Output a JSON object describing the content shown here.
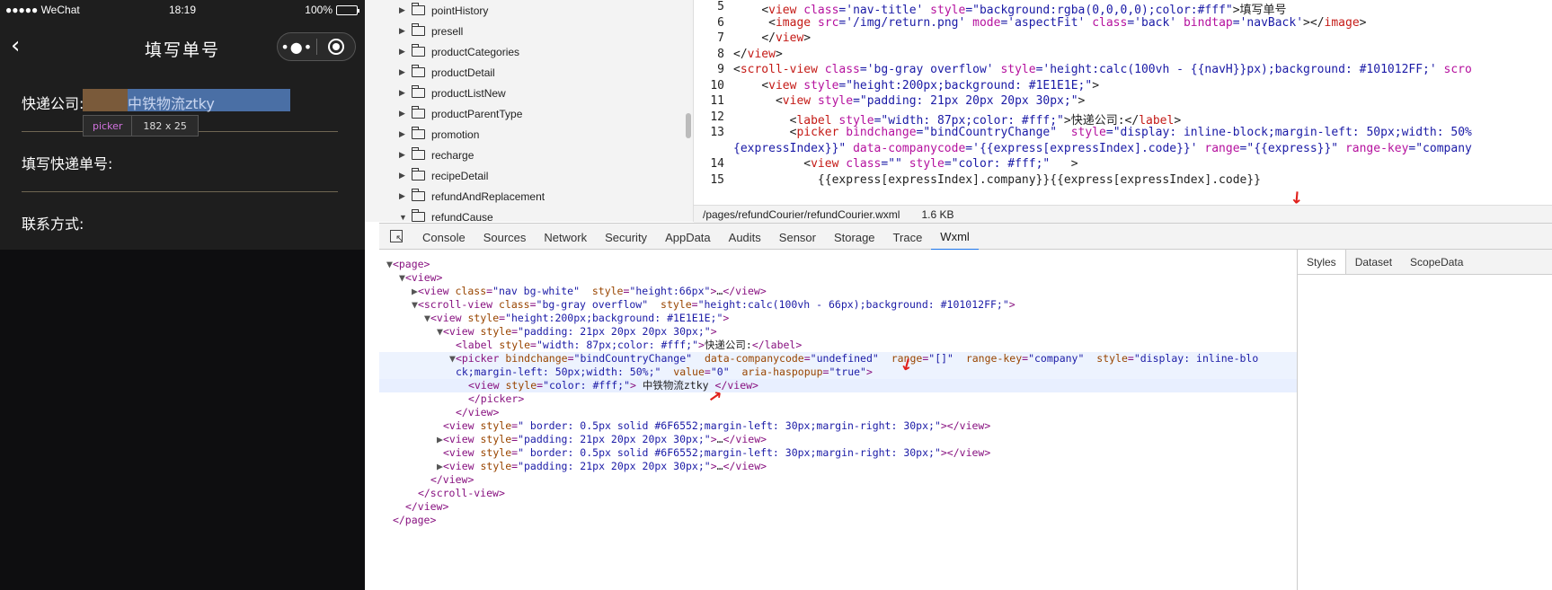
{
  "phone": {
    "carrier": "●●●●● WeChat",
    "time": "18:19",
    "battery": "100%",
    "battery_level": 1.0,
    "nav_title": "填写单号",
    "back_glyph": "‹",
    "more_glyph": "•●•",
    "form": {
      "company_label": "快递公司:",
      "company_value": "中铁物流ztky",
      "tracking_label": "填写快递单号:",
      "contact_label": "联系方式:"
    },
    "tooltip": {
      "tag": "picker",
      "size": "182 x 25"
    }
  },
  "filetree": {
    "items": [
      {
        "name": "pointHistory",
        "expanded": false
      },
      {
        "name": "presell",
        "expanded": false
      },
      {
        "name": "productCategories",
        "expanded": false
      },
      {
        "name": "productDetail",
        "expanded": false
      },
      {
        "name": "productListNew",
        "expanded": false
      },
      {
        "name": "productParentType",
        "expanded": false
      },
      {
        "name": "promotion",
        "expanded": false
      },
      {
        "name": "recharge",
        "expanded": false
      },
      {
        "name": "recipeDetail",
        "expanded": false
      },
      {
        "name": "refundAndReplacement",
        "expanded": false
      },
      {
        "name": "refundCause",
        "expanded": true
      }
    ]
  },
  "editor": {
    "lines": [
      {
        "n": "5",
        "indent": "    ",
        "html": "<span class='t'>&lt;</span><span class='r'>view</span> <span class='a'>class</span>=<span class='s'>'nav-title'</span> <span class='a'>style</span>=<span class='s'>\"background:rgba(0,0,0,0);color:#fff\"</span><span class='t'>&gt;填写单号</span>"
      },
      {
        "n": "6",
        "indent": "     ",
        "html": "<span class='t'>&lt;</span><span class='r'>image</span> <span class='a'>src</span>=<span class='s'>'/img/return.png'</span> <span class='a'>mode</span>=<span class='s'>'aspectFit'</span> <span class='a'>class</span>=<span class='s'>'back'</span> <span class='a'>bindtap</span>=<span class='s'>'navBack'</span><span class='t'>&gt;&lt;/</span><span class='r'>image</span><span class='t'>&gt;</span>"
      },
      {
        "n": "7",
        "indent": "    ",
        "html": "<span class='t'>&lt;/</span><span class='r'>view</span><span class='t'>&gt;</span>"
      },
      {
        "n": "8",
        "indent": "",
        "html": "<span class='t'>&lt;/</span><span class='r'>view</span><span class='t'>&gt;</span>"
      },
      {
        "n": "9",
        "indent": "",
        "html": "<span class='t'>&lt;</span><span class='r'>scroll-view</span> <span class='a'>class</span>=<span class='s'>'bg-gray overflow'</span> <span class='a'>style</span>=<span class='s'>'height:calc(100vh - {{navH}}px);background: #101012FF;'</span> <span class='a'>scro</span>"
      },
      {
        "n": "10",
        "indent": "    ",
        "html": "<span class='t'>&lt;</span><span class='r'>view</span> <span class='a'>style</span>=<span class='s'>\"height:200px;background: #1E1E1E;\"</span><span class='t'>&gt;</span>"
      },
      {
        "n": "11",
        "indent": "      ",
        "html": "<span class='t'>&lt;</span><span class='r'>view</span> <span class='a'>style</span>=<span class='s'>\"padding: 21px 20px 20px 30px;\"</span><span class='t'>&gt;</span>"
      },
      {
        "n": "12",
        "indent": "        ",
        "html": "<span class='t'>&lt;</span><span class='r'>label</span> <span class='a'>style</span>=<span class='s'>\"width: 87px;color: #fff;\"</span><span class='t'>&gt;快递公司:&lt;/</span><span class='r'>label</span><span class='t'>&gt;</span>"
      },
      {
        "n": "13",
        "indent": "        ",
        "html": "<span class='t'>&lt;</span><span class='r'>picker</span> <span class='a'>bindchange</span>=<span class='s'>\"bindCountryChange\"</span>  <span class='a'>style</span>=<span class='s'>\"display: inline-block;margin-left: 50px;width: 50%</span>"
      },
      {
        "n": "",
        "indent": "",
        "html": "<span class='s'>{expressIndex}}\"</span> <span class='a'>data-companycode</span>=<span class='s'>'{{express[expressIndex].code}}'</span> <span class='a'>range</span>=<span class='s'>\"{{express}}\"</span> <span class='a'>range-key</span>=<span class='s'>\"company</span>"
      },
      {
        "n": "14",
        "indent": "          ",
        "html": "<span class='t'>&lt;</span><span class='r'>view</span> <span class='a'>class</span>=<span class='s'>\"\"</span> <span class='a'>style</span>=<span class='s'>\"color: #fff;\"</span>   <span class='t'>&gt;</span>"
      },
      {
        "n": "15",
        "indent": "            ",
        "html": "<span class='t'>{{express[expressIndex].company}}{{express[expressIndex].code}}</span>"
      }
    ],
    "path": "/pages/refundCourier/refundCourier.wxml",
    "size": "1.6 KB"
  },
  "devtabs": [
    "Console",
    "Sources",
    "Network",
    "Security",
    "AppData",
    "Audits",
    "Sensor",
    "Storage",
    "Trace",
    "Wxml"
  ],
  "devtabs_active": "Wxml",
  "wxml": [
    {
      "i": 0,
      "tri": "▼",
      "html": "<span class='tg'>&lt;page&gt;</span>"
    },
    {
      "i": 1,
      "tri": "▼",
      "html": "<span class='tg'>&lt;view&gt;</span>"
    },
    {
      "i": 2,
      "tri": "▶",
      "html": "<span class='tg'>&lt;view</span> <span class='an'>class</span>=<span class='av'>\"nav bg-white\"</span>  <span class='an'>style</span>=<span class='av'>\"height:66px\"</span><span class='tg'>&gt;</span><span class='tx'>…</span><span class='tg'>&lt;/view&gt;</span>"
    },
    {
      "i": 2,
      "tri": "▼",
      "html": "<span class='tg'>&lt;scroll-view</span> <span class='an'>class</span>=<span class='av'>\"bg-gray overflow\"</span>  <span class='an'>style</span>=<span class='av'>\"height:calc(100vh - 66px);background: #101012FF;\"</span><span class='tg'>&gt;</span>"
    },
    {
      "i": 3,
      "tri": "▼",
      "html": "<span class='tg'>&lt;view</span> <span class='an'>style</span>=<span class='av'>\"height:200px;background: #1E1E1E;\"</span><span class='tg'>&gt;</span>"
    },
    {
      "i": 4,
      "tri": "▼",
      "html": "<span class='tg'>&lt;view</span> <span class='an'>style</span>=<span class='av'>\"padding: 21px 20px 20px 30px;\"</span><span class='tg'>&gt;</span>"
    },
    {
      "i": 5,
      "tri": "",
      "html": "<span class='tg'>&lt;label</span> <span class='an'>style</span>=<span class='av'>\"width: 87px;color: #fff;\"</span><span class='tg'>&gt;</span><span class='tx'>快递公司:</span><span class='tg'>&lt;/label&gt;</span>"
    },
    {
      "i": 5,
      "tri": "▼",
      "hl": true,
      "html": "<span class='tg'>&lt;picker</span> <span class='an'>bindchange</span>=<span class='av'>\"bindCountryChange\"</span>  <span class='an'>data-companycode</span>=<span class='av'>\"undefined\"</span>  <span class='an'>range</span>=<span class='av'>\"[]\"</span>  <span class='an'>range-key</span>=<span class='av'>\"company\"</span>  <span class='an'>style</span>=<span class='av'>\"display: inline-blo</span>"
    },
    {
      "i": 5,
      "tri": "",
      "hl": true,
      "html": "<span class='av'>ck;margin-left: 50px;width: 50%;\"</span>  <span class='an'>value</span>=<span class='av'>\"0\"</span>  <span class='an'>aria-haspopup</span>=<span class='av'>\"true\"</span><span class='tg'>&gt;</span>"
    },
    {
      "i": 6,
      "tri": "",
      "sel": true,
      "html": "<span class='tg'>&lt;view</span> <span class='an'>style</span>=<span class='av'>\"color: #fff;\"</span><span class='tg'>&gt;</span> <span class='tx'>中铁物流ztky</span> <span class='tg'>&lt;/view&gt;</span>"
    },
    {
      "i": 6,
      "tri": "",
      "html": "<span class='tg'>&lt;/picker&gt;</span>"
    },
    {
      "i": 5,
      "tri": "",
      "html": "<span class='tg'>&lt;/view&gt;</span>"
    },
    {
      "i": 4,
      "tri": "",
      "html": "<span class='tg'>&lt;view</span> <span class='an'>style</span>=<span class='av'>\" border: 0.5px solid #6F6552;margin-left: 30px;margin-right: 30px;\"</span><span class='tg'>&gt;&lt;/view&gt;</span>"
    },
    {
      "i": 4,
      "tri": "▶",
      "html": "<span class='tg'>&lt;view</span> <span class='an'>style</span>=<span class='av'>\"padding: 21px 20px 20px 30px;\"</span><span class='tg'>&gt;</span><span class='tx'>…</span><span class='tg'>&lt;/view&gt;</span>"
    },
    {
      "i": 4,
      "tri": "",
      "html": "<span class='tg'>&lt;view</span> <span class='an'>style</span>=<span class='av'>\" border: 0.5px solid #6F6552;margin-left: 30px;margin-right: 30px;\"</span><span class='tg'>&gt;&lt;/view&gt;</span>"
    },
    {
      "i": 4,
      "tri": "▶",
      "html": "<span class='tg'>&lt;view</span> <span class='an'>style</span>=<span class='av'>\"padding: 21px 20px 20px 30px;\"</span><span class='tg'>&gt;</span><span class='tx'>…</span><span class='tg'>&lt;/view&gt;</span>"
    },
    {
      "i": 3,
      "tri": "",
      "html": "<span class='tg'>&lt;/view&gt;</span>"
    },
    {
      "i": 2,
      "tri": "",
      "html": "<span class='tg'>&lt;/scroll-view&gt;</span>"
    },
    {
      "i": 1,
      "tri": "",
      "html": "<span class='tg'>&lt;/view&gt;</span>"
    },
    {
      "i": 0,
      "tri": "",
      "html": "<span class='tg'>&lt;/page&gt;</span>"
    }
  ],
  "rightpanel": {
    "tabs": [
      "Styles",
      "Dataset",
      "ScopeData"
    ],
    "active": "Styles"
  },
  "colors": {
    "accent": "#1a73e8",
    "divider": "#6f6552",
    "arrow": "#e0201b"
  }
}
